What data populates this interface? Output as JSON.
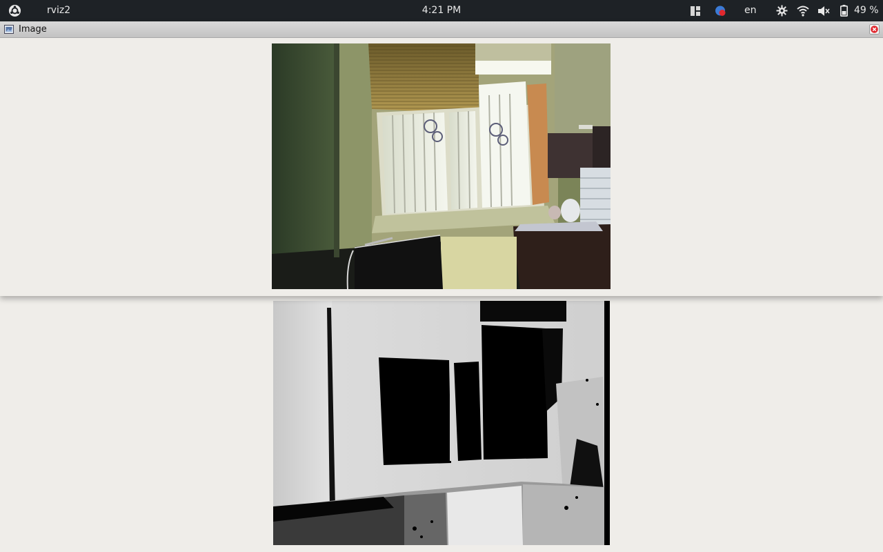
{
  "topbar": {
    "app_name": "rviz2",
    "clock": "4:21 PM",
    "language": "en",
    "battery": "49 %"
  },
  "window": {
    "title": "Image"
  },
  "icons": [
    "ubuntu-logo-icon",
    "workspace-icon",
    "notification-icon",
    "settings-icon",
    "wifi-icon",
    "volume-muted-icon",
    "battery-icon",
    "window-app-icon",
    "close-icon"
  ],
  "colors": {
    "topbar_bg": "#1e2226",
    "window_bg": "#efede9",
    "close_red": "#e0282e"
  }
}
